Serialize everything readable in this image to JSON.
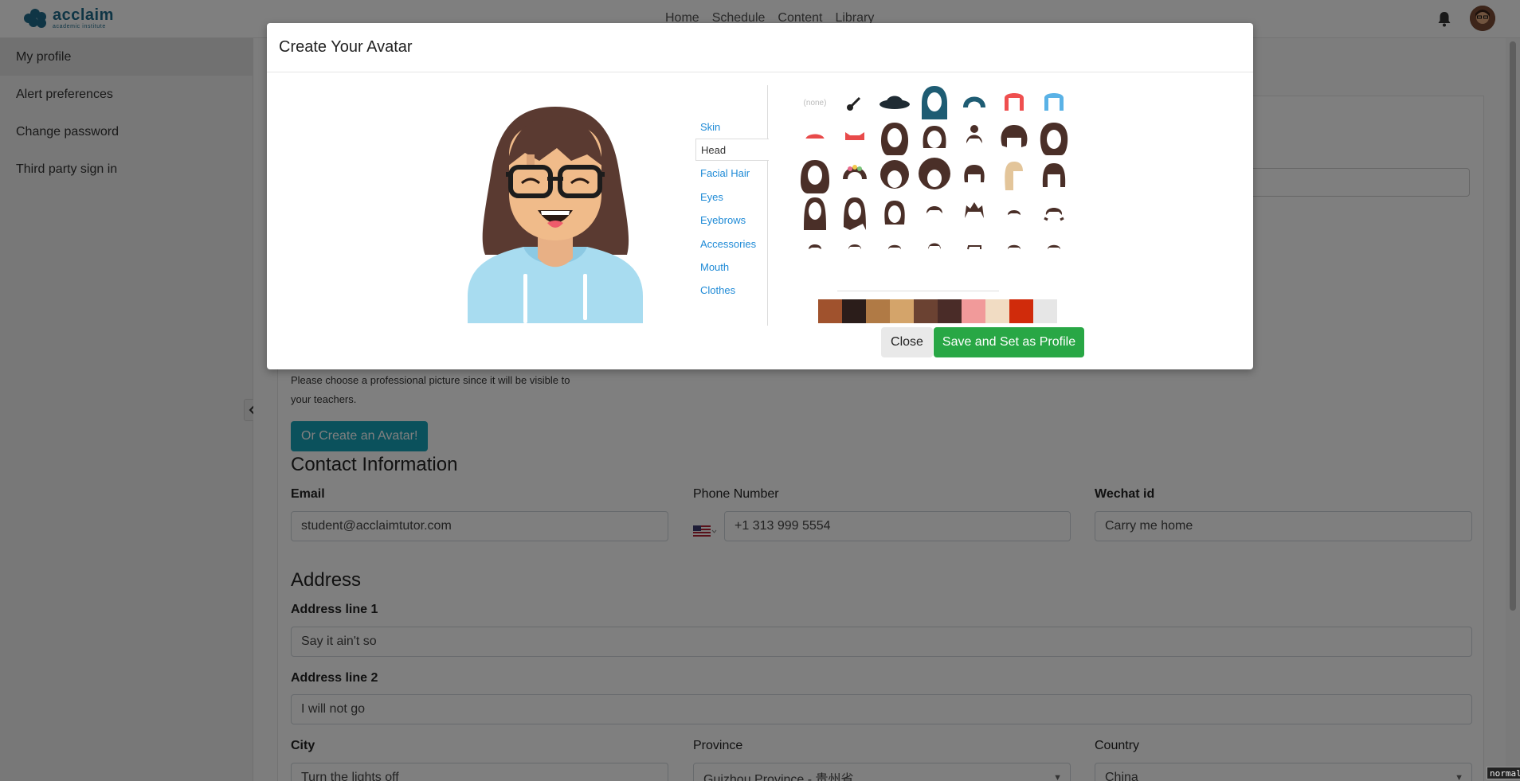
{
  "brand": {
    "name": "acclaim",
    "tagline": "academic institute"
  },
  "nav": {
    "links": [
      "Home",
      "Schedule",
      "Content",
      "Library"
    ]
  },
  "sidebar": {
    "items": [
      {
        "label": "My profile",
        "active": true
      },
      {
        "label": "Alert preferences"
      },
      {
        "label": "Change password"
      },
      {
        "label": "Third party sign in"
      }
    ]
  },
  "profile": {
    "picture_note": "Please choose a professional picture since it will be visible to your teachers.",
    "create_avatar_button": "Or Create an Avatar!",
    "contact": {
      "heading": "Contact Information",
      "email_label": "Email",
      "email_value": "student@acclaimtutor.com",
      "phone_label": "Phone Number",
      "phone_value": "+1 313 999 5554",
      "wechat_label": "Wechat id",
      "wechat_value": "Carry me home"
    },
    "address": {
      "heading": "Address",
      "line1_label": "Address line 1",
      "line1_value": "Say it ain't so",
      "line2_label": "Address line 2",
      "line2_value": "I will not go",
      "city_label": "City",
      "city_value": "Turn the lights off",
      "province_label": "Province",
      "province_value": "Guizhou Province - 贵州省",
      "country_label": "Country",
      "country_value": "China"
    }
  },
  "modal": {
    "title": "Create Your Avatar",
    "categories": [
      "Skin",
      "Head",
      "Facial Hair",
      "Eyes",
      "Eyebrows",
      "Accessories",
      "Mouth",
      "Clothes"
    ],
    "active_category": "Head",
    "none_label": "(none)",
    "close_button": "Close",
    "save_button": "Save and Set as Profile",
    "swatches": [
      "#a0522d",
      "#2b1d1a",
      "#b07a45",
      "#d4a46a",
      "#6b4232",
      "#4a2c28",
      "#f19a9a",
      "#f1dcc3",
      "#d02b0b",
      "#e6e6e6"
    ]
  },
  "status_badge": "normal"
}
